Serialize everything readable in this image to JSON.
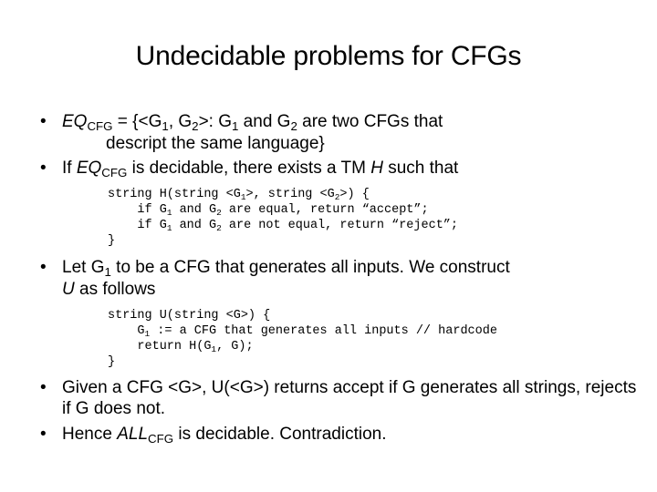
{
  "slide": {
    "title": "Undecidable problems for CFGs",
    "background_color": "#ffffff",
    "text_color": "#000000",
    "bullet_marker": "•"
  },
  "bullets": {
    "b1": {
      "line1_pre": "EQ",
      "line1_sub": "CFG",
      "line1_post": " = {<G",
      "line1_sub2": "1",
      "line1_mid": ", G",
      "line1_sub3": "2",
      "line1_mid2": ">: G",
      "line1_sub4": "1",
      "line1_mid3": " and G",
      "line1_sub5": "2",
      "line1_tail": " are two CFGs that",
      "line2": "descript the same language}"
    },
    "b2": {
      "pre": "If ",
      "italic": "EQ",
      "sub": "CFG",
      "mid": " is decidable, there exists a TM ",
      "italic2": "H",
      "tail": " such that"
    },
    "b3": {
      "pre": "Let G",
      "sub": "1",
      "mid": " to be a CFG that generates all inputs. We construct",
      "italic": "U",
      "tail": " as follows"
    },
    "b4": {
      "text": "Given a CFG <G>, U(<G>) returns accept if G generates all strings, rejects if G does not."
    },
    "b5": {
      "pre": "Hence ",
      "italic": "ALL",
      "sub": "CFG",
      "tail": " is decidable. Contradiction."
    }
  },
  "code_block_1": {
    "line1_a": "string H(string <G",
    "line1_sub1": "1",
    "line1_b": ">, string <G",
    "line1_sub2": "2",
    "line1_c": ">) {",
    "line2_a": "    if G",
    "line2_sub1": "1",
    "line2_b": " and G",
    "line2_sub2": "2",
    "line2_c": " are equal, return “accept”;",
    "line3_a": "    if G",
    "line3_sub1": "1",
    "line3_b": " and G",
    "line3_sub2": "2",
    "line3_c": " are not equal, return “reject”;",
    "line4": "}"
  },
  "code_block_2": {
    "line1": "string U(string <G>) {",
    "line2_a": "    G",
    "line2_sub1": "1",
    "line2_b": " := a CFG that generates all inputs // hardcode",
    "line3_a": "    return H(G",
    "line3_sub1": "1",
    "line3_b": ", G);",
    "line4": "}"
  }
}
